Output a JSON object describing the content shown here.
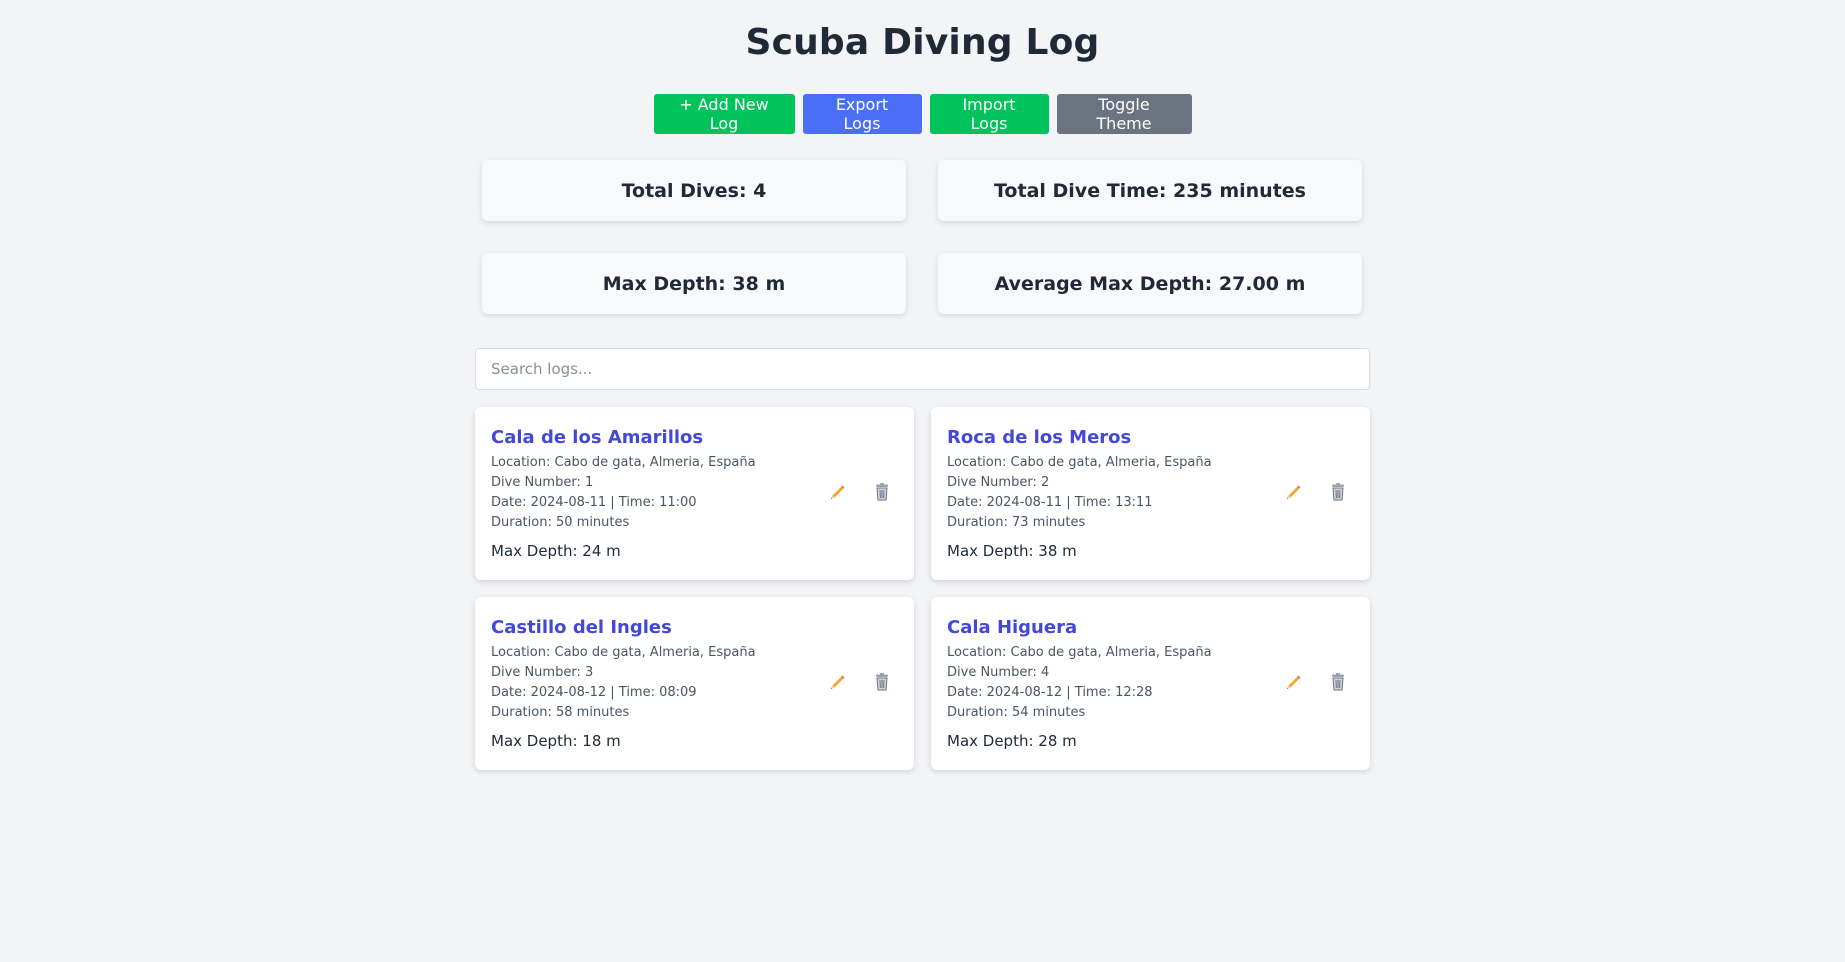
{
  "header": {
    "title": "Scuba Diving Log"
  },
  "toolbar": {
    "add_label": "+ Add New Log",
    "export_label": "Export Logs",
    "import_label": "Import Logs",
    "toggle_label": "Toggle Theme"
  },
  "stats": {
    "total_dives": "Total Dives: 4",
    "total_time": "Total Dive Time: 235 minutes",
    "max_depth": "Max Depth: 38 m",
    "avg_depth": "Average Max Depth: 27.00 m"
  },
  "search": {
    "placeholder": "Search logs...",
    "value": ""
  },
  "logs": [
    {
      "name": "Cala de los Amarillos",
      "location": "Location: Cabo de gata, Almeria, España",
      "dive_number": "Dive Number: 1",
      "datetime": "Date: 2024-08-11 | Time: 11:00",
      "duration": "Duration: 50 minutes",
      "max_depth": "Max Depth: 24 m"
    },
    {
      "name": "Roca de los Meros",
      "location": "Location: Cabo de gata, Almeria, España",
      "dive_number": "Dive Number: 2",
      "datetime": "Date: 2024-08-11 | Time: 13:11",
      "duration": "Duration: 73 minutes",
      "max_depth": "Max Depth: 38 m"
    },
    {
      "name": "Castillo del Ingles",
      "location": "Location: Cabo de gata, Almeria, España",
      "dive_number": "Dive Number: 3",
      "datetime": "Date: 2024-08-12 | Time: 08:09",
      "duration": "Duration: 58 minutes",
      "max_depth": "Max Depth: 18 m"
    },
    {
      "name": "Cala Higuera",
      "location": "Location: Cabo de gata, Almeria, España",
      "dive_number": "Dive Number: 4",
      "datetime": "Date: 2024-08-12 | Time: 12:28",
      "duration": "Duration: 54 minutes",
      "max_depth": "Max Depth: 28 m"
    }
  ],
  "icons": {
    "edit": "pencil-icon",
    "delete": "trash-icon"
  },
  "colors": {
    "background": "#f3f4f6",
    "green": "#00c35b",
    "blue": "#4a6ef5",
    "gray": "#6b7280",
    "link": "#4349d6"
  }
}
